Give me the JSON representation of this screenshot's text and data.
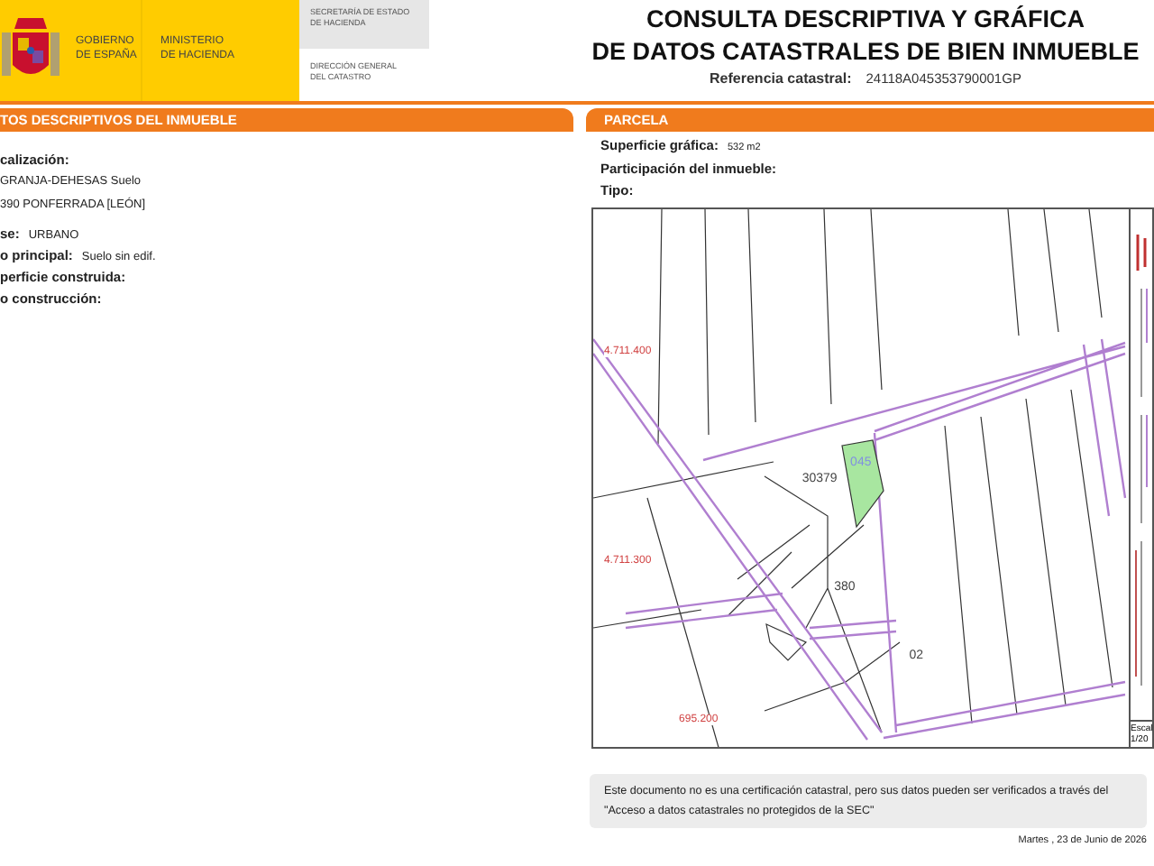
{
  "header": {
    "government": [
      "GOBIERNO",
      "DE ESPAÑA"
    ],
    "ministry": [
      "MINISTERIO",
      "DE HACIENDA"
    ],
    "secretariat": [
      "SECRETARÍA DE ESTADO",
      "DE HACIENDA"
    ],
    "directorate": [
      "DIRECCIÓN GENERAL",
      "DEL CATASTRO"
    ],
    "title": [
      "CONSULTA DESCRIPTIVA Y GRÁFICA",
      "DE DATOS CATASTRALES DE BIEN INMUEBLE"
    ],
    "reference_label": "Referencia catastral:",
    "reference_value": "24118A045353790001GP"
  },
  "property": {
    "heading": "TOS DESCRIPTIVOS DEL INMUEBLE",
    "location_label": "calización:",
    "location_lines": [
      "GRANJA-DEHESAS  Suelo",
      "390 PONFERRADA [LEÓN]"
    ],
    "fields": [
      {
        "label": "se:",
        "value": "URBANO"
      },
      {
        "label": "o principal:",
        "value": "Suelo sin edif."
      },
      {
        "label": "perficie construida:"
      },
      {
        "label": "o construcción:"
      }
    ]
  },
  "parcel": {
    "heading": "PARCELA",
    "fields": [
      {
        "label": "Superficie gráfica:",
        "value": "532 m2"
      },
      {
        "label": "Participación del inmueble:"
      },
      {
        "label": "Tipo:"
      }
    ],
    "map_labels": [
      {
        "text": "4.711.400",
        "kind": "coordinate"
      },
      {
        "text": "4.711.300",
        "kind": "coordinate"
      },
      {
        "text": "695.200",
        "kind": "coordinate"
      },
      {
        "text": "045",
        "kind": "parcel"
      },
      {
        "text": "30379",
        "kind": "number"
      },
      {
        "text": "380",
        "kind": "number"
      },
      {
        "text": "02",
        "kind": "number"
      }
    ],
    "scale": [
      "Escal",
      "1/20"
    ]
  },
  "footer": {
    "notice": "Este documento no es una certificación catastral, pero sus datos pueden ser verificados a través del \"Acceso a datos catastrales no protegidos de la SEC\"",
    "date": "Martes , 23 de Junio de 2026"
  }
}
